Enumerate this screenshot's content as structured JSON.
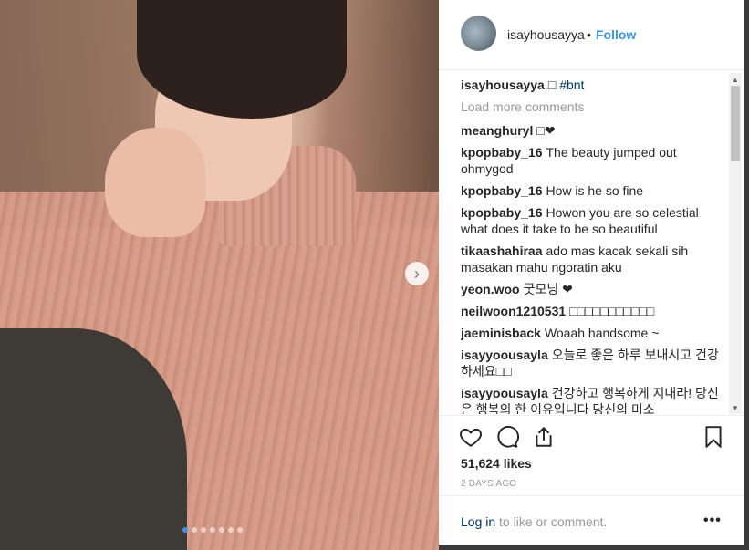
{
  "post": {
    "username": "isayhousayya",
    "separator": "•",
    "follow_label": "Follow"
  },
  "caption": {
    "username": "isayhousayya",
    "emoji": "□",
    "hashtag": "#bnt"
  },
  "load_more_label": "Load more comments",
  "comments": [
    {
      "user": "meanghuryl",
      "text": "□❤"
    },
    {
      "user": "kpopbaby_16",
      "text": "The beauty jumped out ohmygod"
    },
    {
      "user": "kpopbaby_16",
      "text": "How is he so fine"
    },
    {
      "user": "kpopbaby_16",
      "text": "Howon you are so celestial what does it take to be so beautiful"
    },
    {
      "user": "tikaashahiraa",
      "text": "ado mas kacak sekali sih masakan mahu ngoratin aku"
    },
    {
      "user": "yeon.woo",
      "text": "굿모닝 ❤"
    },
    {
      "user": "neilwoon1210531",
      "text": "□□□□□□□□□□□"
    },
    {
      "user": "jaeminisback",
      "text": "Woaah handsome ~"
    },
    {
      "user": "isayyoousayla",
      "text": "오늘로 좋은 하루 보내시고 건강하세요□□"
    },
    {
      "user": "isayyoousayla",
      "text": "건강하고 행복하게 지내라! 당신은 행복의 한 이유입니다 당신의 미소"
    }
  ],
  "likes_text": "51,624 likes",
  "timestamp": "2 DAYS AGO",
  "footer": {
    "login_link": "Log in",
    "login_rest": " to like or comment.",
    "more_label": "•••"
  },
  "carousel": {
    "next_symbol": "›",
    "dot_count": 7,
    "active_index": 0
  },
  "icons": {
    "heart": "heart-icon",
    "comment": "comment-icon",
    "share": "share-icon",
    "save": "bookmark-icon"
  },
  "colors": {
    "link": "#3897f0",
    "text": "#262626",
    "muted": "#999999",
    "active_dot": "#3b95f0"
  }
}
